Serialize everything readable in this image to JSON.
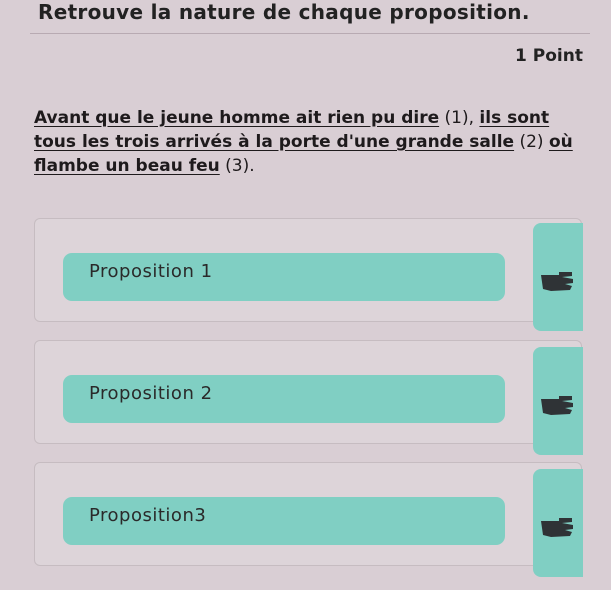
{
  "question": {
    "title": "Retrouve la nature de chaque proposition.",
    "points": "1 Point"
  },
  "sentence": {
    "part1": "Avant que le jeune homme ait rien pu dire",
    "num1": " (1), ",
    "part2": "ils sont tous les trois arrivés à la porte d'une grande salle",
    "num2": " (2) ",
    "part3": "où flambe un beau feu",
    "num3": " (3)."
  },
  "answers": [
    {
      "label": "Proposition 1"
    },
    {
      "label": "Proposition 2"
    },
    {
      "label": "Proposition3"
    }
  ],
  "colors": {
    "background": "#d9ced4",
    "drop_zone": "#80cfc3",
    "pointer_icon": "#2f3336"
  },
  "icons": [
    "pointing-hand-icon"
  ]
}
